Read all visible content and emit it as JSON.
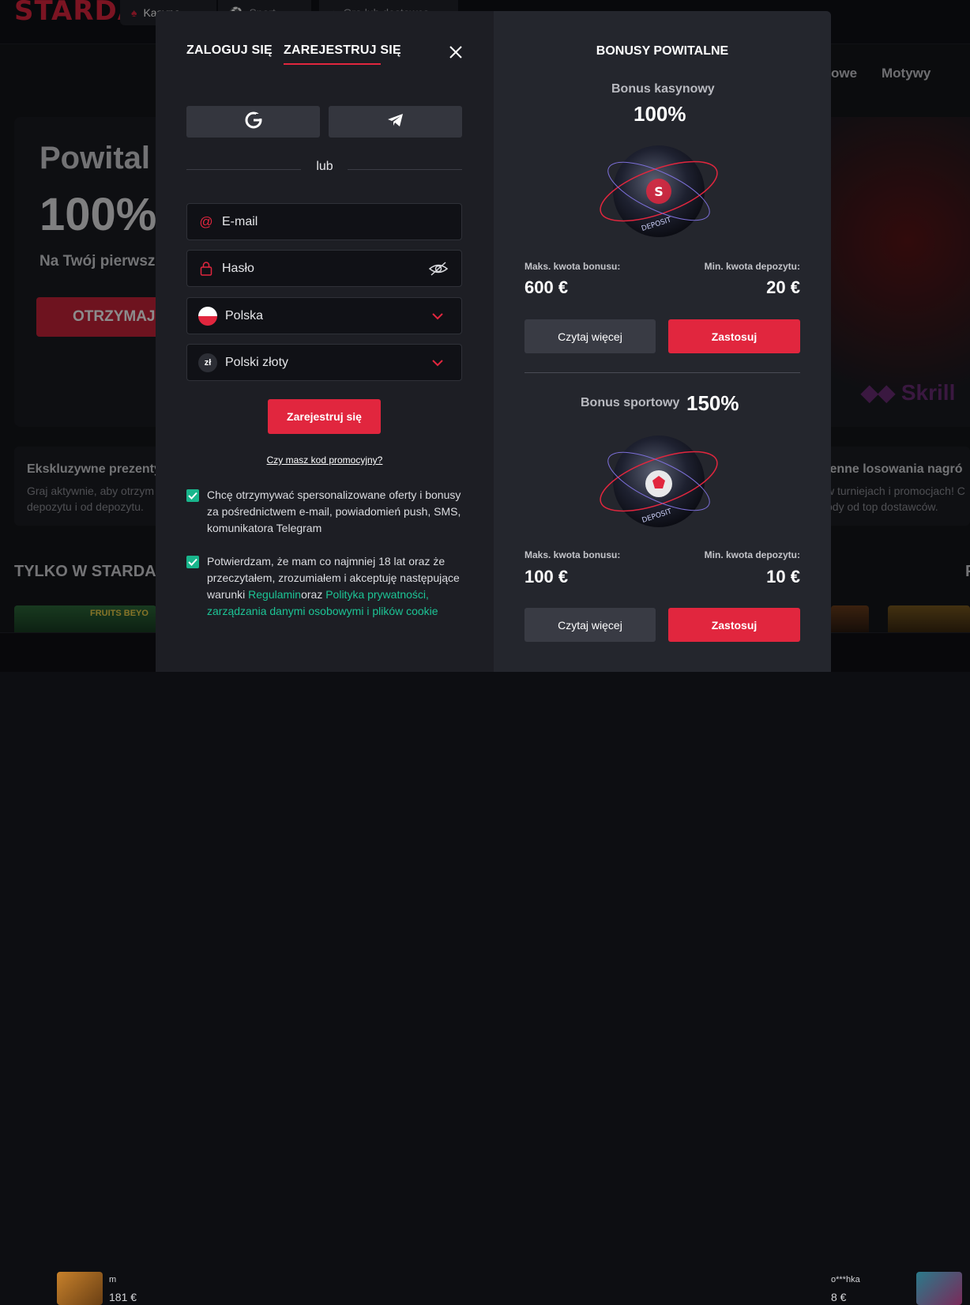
{
  "background": {
    "logo": "STARDA",
    "tabs": [
      "Kasyno",
      "Sport",
      "Gra lub dostawca"
    ],
    "nav_partial": [
      "owe",
      "Motywy"
    ],
    "hero": {
      "title": "Powital",
      "big": "100%",
      "subtitle": "Na Twój pierwsz",
      "button": "OTRZYMAJ"
    },
    "skrill": "Skrill",
    "promo_left": {
      "title": "Ekskluzywne prezenty",
      "text1": "Graj aktywnie, aby otrzym",
      "text2": "depozytu i od depozytu."
    },
    "promo_right": {
      "title": "ienne losowania nagró",
      "text1": "w turniejach i promocjach! C",
      "text2": "ody od top dostawców."
    },
    "section_title": "TYLKO W STARDA",
    "section_right": "P",
    "thumb_label": "FRUITS BEYO",
    "bottom": {
      "item1_name": "m",
      "item1_amount": "181 €",
      "item2_name": "o***hka",
      "item2_amount": "8 €"
    }
  },
  "modal": {
    "tabs": {
      "login": "ZALOGUJ SIĘ",
      "register": "ZAREJESTRUJ SIĘ"
    },
    "or_label": "lub",
    "email_placeholder": "E-mail",
    "password_placeholder": "Hasło",
    "country": "Polska",
    "currency_symbol": "zł",
    "currency": "Polski złoty",
    "register_button": "Zarejestruj się",
    "promo_link": "Czy masz kod promocyjny?",
    "consent1": "Chcę otrzymywać spersonalizowane oferty i bonusy za pośrednictwem e-mail, powiadomień push, SMS, komunikatora Telegram",
    "consent2_a": "Potwierdzam, że mam co najmniej 18 lat oraz że przeczytałem, zrozumiałem i akceptuję następujące warunki ",
    "consent2_link1": "Regulamin",
    "consent2_b": "oraz ",
    "consent2_link2": "Polityka prywatności, zarządzania danymi osobowymi i plików cookie",
    "bonuses_title": "BONUSY POWITALNE",
    "casino": {
      "label": "Bonus kasynowy",
      "percent": "100%",
      "max_label": "Maks. kwota bonusu:",
      "max_value": "600 €",
      "min_label": "Min. kwota depozytu:",
      "min_value": "20 €",
      "read_more": "Czytaj więcej",
      "apply": "Zastosuj"
    },
    "sport": {
      "label": "Bonus sportowy",
      "percent": "150%",
      "max_label": "Maks. kwota bonusu:",
      "max_value": "100 €",
      "min_label": "Min. kwota depozytu:",
      "min_value": "10 €",
      "read_more": "Czytaj więcej",
      "apply": "Zastosuj"
    },
    "orb_text": "DEPOSIT"
  },
  "colors": {
    "accent": "#e1263e",
    "check": "#19b58c",
    "link": "#1cc495"
  }
}
